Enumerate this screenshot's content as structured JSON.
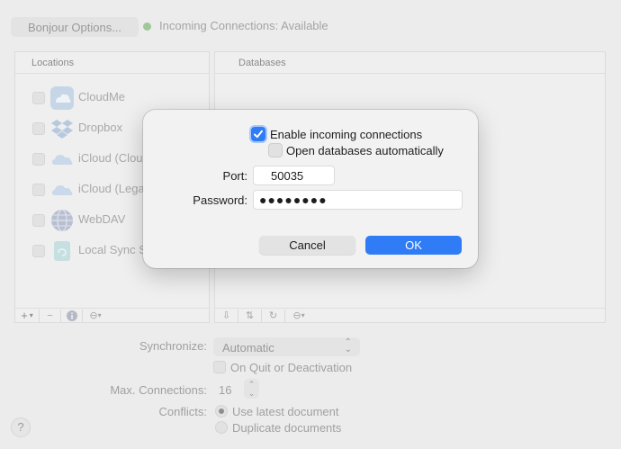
{
  "header": {
    "bonjour_button": "Bonjour Options...",
    "status": "Incoming Connections: Available",
    "status_color": "#9fc79a"
  },
  "locations": {
    "title": "Locations",
    "items": [
      {
        "label": "CloudMe",
        "icon": "cloudme-icon"
      },
      {
        "label": "Dropbox",
        "icon": "dropbox-icon"
      },
      {
        "label": "iCloud (CloudKit)",
        "icon": "icloud-icon"
      },
      {
        "label": "iCloud (Legacy)",
        "icon": "icloud-icon"
      },
      {
        "label": "WebDAV",
        "icon": "webdav-icon"
      },
      {
        "label": "Local Sync Store",
        "icon": "folder-icon"
      }
    ],
    "toolbar": {
      "add": "+",
      "remove": "−"
    }
  },
  "databases": {
    "title": "Databases"
  },
  "settings": {
    "sync_label": "Synchronize:",
    "sync_value": "Automatic",
    "quit_label": "On Quit or Deactivation",
    "max_conn_label": "Max. Connections:",
    "max_conn_value": "16",
    "conflicts_label": "Conflicts:",
    "conflict_options": [
      "Use latest document",
      "Duplicate documents"
    ],
    "help": "?"
  },
  "dialog": {
    "enable_label": "Enable incoming connections",
    "open_db_label": "Open databases automatically",
    "port_label": "Port:",
    "port_value": "50035",
    "password_label": "Password:",
    "password_value": "●●●●●●●●",
    "cancel": "Cancel",
    "ok": "OK",
    "accent": "#2f7cf6"
  }
}
